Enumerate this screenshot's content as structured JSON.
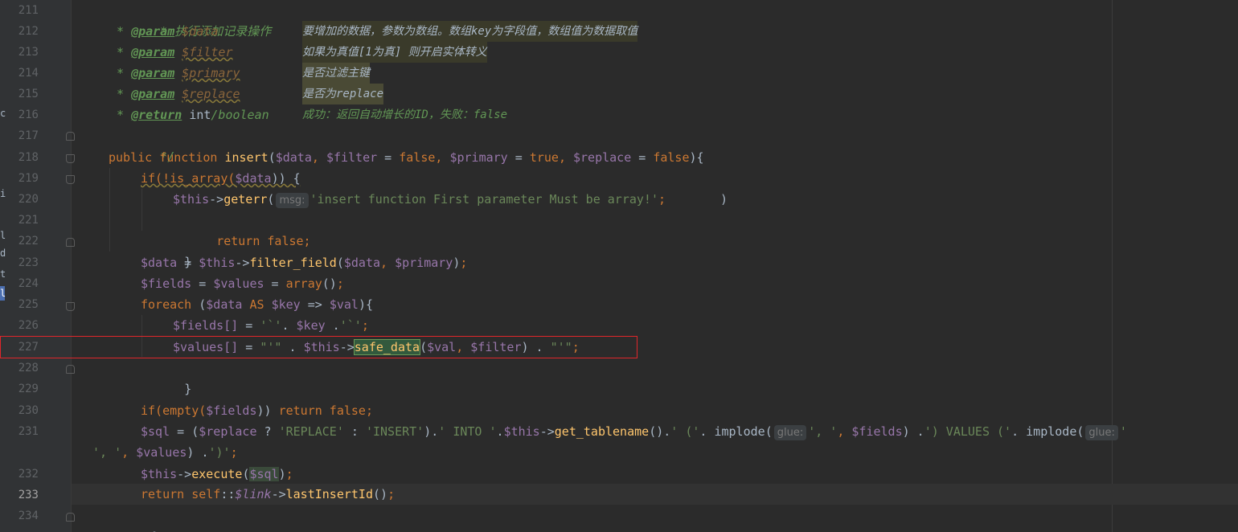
{
  "editor": {
    "left_strip_chars": [
      "c",
      "i",
      "l",
      "d",
      "t",
      "l"
    ],
    "line_numbers": [
      "211",
      "212",
      "213",
      "214",
      "215",
      "216",
      "217",
      "218",
      "219",
      "220",
      "221",
      "222",
      "223",
      "224",
      "225",
      "226",
      "227",
      "228",
      "229",
      "230",
      "231",
      "",
      "232",
      "233",
      "234"
    ],
    "current_line": "233",
    "lines": {
      "l211": {
        "comment": "* 执行添加记录操作"
      },
      "l212": {
        "star": "* ",
        "tag": "@param",
        "var": "$data",
        "desc": "要增加的数据，参数为数组。数组key为字段值，数组值为数据取值"
      },
      "l213": {
        "star": "* ",
        "tag": "@param",
        "var": "$filter",
        "desc": "如果为真值[1为真] 则开启实体转义"
      },
      "l214": {
        "star": "* ",
        "tag": "@param",
        "var": "$primary",
        "desc": "是否过滤主键"
      },
      "l215": {
        "star": "* ",
        "tag": "@param",
        "var": "$replace",
        "desc": "是否为replace"
      },
      "l216": {
        "star": "* ",
        "tag": "@return",
        "type": "int",
        "slash": "/boolean",
        "desc": "成功：返回自动增长的ID，失败：false"
      },
      "l217": {
        "comment": "*/"
      },
      "l218": {
        "kw1": "public",
        "kw2": "function",
        "fn": "insert",
        "p1": "$data",
        "p2": "$filter",
        "v2": "false",
        "p3": "$primary",
        "v3": "true",
        "p4": "$replace",
        "v4": "false"
      },
      "l219": {
        "fn": "if(!is_array(",
        "var": "$data",
        "rest": ")) {"
      },
      "l220": {
        "this": "$this",
        "arrow": "->",
        "fn": "geterr",
        "hint": "msg:",
        "str": "'insert function First parameter Must be array!'"
      },
      "l221": {
        "kw": "return false;"
      },
      "l222": {
        "text": "}"
      },
      "l223": {
        "v1": "$data",
        "this": "$this",
        "fn": "filter_field",
        "v2": "$data",
        "v3": "$primary"
      },
      "l224": {
        "v1": "$fields",
        "v2": "$values",
        "fn": "array"
      },
      "l225": {
        "kw": "foreach",
        "v1": "$data",
        "as": "AS",
        "v2": "$key",
        "v3": "$val"
      },
      "l226": {
        "v1": "$fields[]",
        "s1": "'`'",
        "v2": "$key",
        "s2": "'`'"
      },
      "l227": {
        "v1": "$values[]",
        "s1": "\"'\"",
        "this": "$this",
        "fn": "safe_data",
        "v2": "$val",
        "v3": "$filter",
        "s2": "\"'\""
      },
      "l228": {
        "text": "}"
      },
      "l230": {
        "fn": "if(empty(",
        "var": "$fields",
        "kw": "return false;"
      },
      "l231": {
        "v1": "$sql",
        "v2": "$replace",
        "s1": "'REPLACE'",
        "s2": "'INSERT'",
        "s3": "' INTO '",
        "this": "$this",
        "fn": "get_tablename",
        "s4": "' ('",
        "fn2": "implode",
        "hint": "glue:",
        "s5": "', '",
        "v3": "$fields",
        "s6": "') VALUES ('",
        "fn3": "implode",
        "hint2": "glue:",
        "s7": "'"
      },
      "l231b": {
        "s1": "', '",
        "v1": "$values",
        "s2": "')'"
      },
      "l232": {
        "this": "$this",
        "fn": "execute",
        "var": "$sql"
      },
      "l233": {
        "kw1": "return",
        "kw2": "self",
        "var": "$link",
        "fn": "lastInsertId"
      },
      "l234": {
        "text": "}"
      }
    }
  },
  "colors": {
    "background": "#2b2b2b",
    "keyword": "#cc7832",
    "function": "#ffc66d",
    "variable": "#9876aa",
    "string": "#6a8759",
    "comment": "#629755",
    "highlight_box": "#e0262a"
  }
}
